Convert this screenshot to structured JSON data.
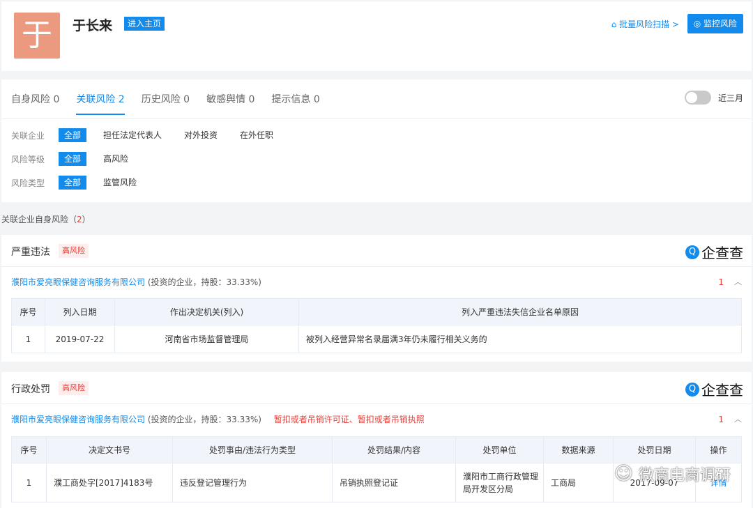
{
  "header": {
    "avatar_char": "于",
    "name": "于长来",
    "enter_home": "进入主页",
    "batch_scan": "⌂ 批量风险扫描 >",
    "monitor": "◎ 监控风险"
  },
  "tabs": [
    {
      "label": "自身风险 0"
    },
    {
      "label": "关联风险 2"
    },
    {
      "label": "历史风险 0"
    },
    {
      "label": "敏感舆情 0"
    },
    {
      "label": "提示信息 0"
    }
  ],
  "toggle_label": "近三月",
  "filters": [
    {
      "label": "关联企业",
      "options": [
        "全部",
        "担任法定代表人",
        "对外投资",
        "在外任职"
      ]
    },
    {
      "label": "风险等级",
      "options": [
        "全部",
        "高风险"
      ]
    },
    {
      "label": "风险类型",
      "options": [
        "全部",
        "监管风险"
      ]
    }
  ],
  "section_title": {
    "prefix": "关联企业自身风险（",
    "count": "2",
    "suffix": "）"
  },
  "logo_text": "企查查",
  "blocks": [
    {
      "title": "严重违法",
      "badge": "高风险",
      "company": "濮阳市爱亮眼保健咨询服务有限公司",
      "meta": "(投资的企业，持股：33.33%)",
      "penalty": "",
      "count": "1",
      "columns": [
        "序号",
        "列入日期",
        "作出决定机关(列入)",
        "列入严重违法失信企业名单原因"
      ],
      "rows": [
        [
          "1",
          "2019-07-22",
          "河南省市场监督管理局",
          "被列入经营异常名录届满3年仍未履行相关义务的"
        ]
      ]
    },
    {
      "title": "行政处罚",
      "badge": "高风险",
      "company": "濮阳市爱亮眼保健咨询服务有限公司",
      "meta": "(投资的企业，持股：33.33%)",
      "penalty": "暂扣或者吊销许可证、暂扣或者吊销执照",
      "count": "1",
      "columns": [
        "序号",
        "决定文书号",
        "处罚事由/违法行为类型",
        "处罚结果/内容",
        "处罚单位",
        "数据来源",
        "处罚日期",
        "操作"
      ],
      "rows": [
        [
          "1",
          "濮工商处字[2017]4183号",
          "违反登记管理行为",
          "吊销执照登记证",
          "濮阳市工商行政管理局开发区分局",
          "工商局",
          "2017-09-07",
          "详情"
        ]
      ]
    }
  ],
  "watermark": {
    "icon": "☺",
    "text": "微商电商调研"
  }
}
